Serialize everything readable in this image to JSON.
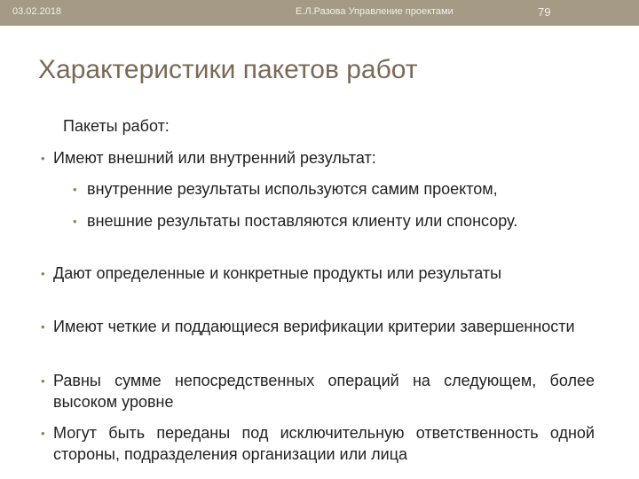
{
  "header": {
    "date": "03.02.2018",
    "author": "Е.Л.Разова Управление проектами",
    "page_number": "79"
  },
  "title": "Характеристики пакетов работ",
  "subtitle": "Пакеты работ:",
  "bullets": [
    {
      "level": 1,
      "text": "Имеют внешний или внутренний результат:"
    },
    {
      "level": 2,
      "text": "внутренние результаты используются самим проектом,"
    },
    {
      "level": 2,
      "text": "внешние результаты поставляются клиенту или спонсору."
    },
    {
      "level": 1,
      "text": "Дают определенные и конкретные продукты или результаты"
    },
    {
      "level": 1,
      "text": "Имеют четкие и поддающиеся верификации критерии завершенности"
    },
    {
      "level": 1,
      "text": "Равны сумме непосредственных операций на следующем, более высоком уровне"
    },
    {
      "level": 1,
      "text": "Могут быть переданы под исключительную ответственность одной стороны, подразделения организации или лица"
    }
  ],
  "colors": {
    "header_bar": "#a49a85",
    "title": "#7a6a55",
    "bullet": "#8a7e68"
  }
}
